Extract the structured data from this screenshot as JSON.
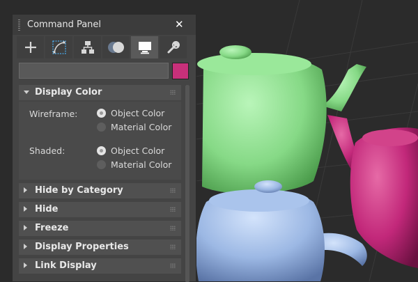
{
  "panel": {
    "title": "Command Panel",
    "close_label": "✕",
    "tabs": [
      {
        "icon": "create-icon",
        "active": false
      },
      {
        "icon": "modify-icon",
        "active": false
      },
      {
        "icon": "hierarchy-icon",
        "active": false
      },
      {
        "icon": "motion-icon",
        "active": false
      },
      {
        "icon": "display-icon",
        "active": true
      },
      {
        "icon": "utilities-icon",
        "active": false
      }
    ],
    "name_field": {
      "value": ""
    },
    "swatch_color": "#c8307a"
  },
  "display_color": {
    "label": "Display Color",
    "wireframe": {
      "label": "Wireframe:",
      "options": [
        "Object Color",
        "Material Color"
      ],
      "selected": "Object Color"
    },
    "shaded": {
      "label": "Shaded:",
      "options": [
        "Object Color",
        "Material Color"
      ],
      "selected": "Object Color"
    }
  },
  "rollouts": [
    {
      "label": "Hide by Category"
    },
    {
      "label": "Hide"
    },
    {
      "label": "Freeze"
    },
    {
      "label": "Display Properties"
    },
    {
      "label": "Link Display"
    }
  ],
  "scene": {
    "teapots": [
      {
        "name": "green-teapot",
        "color": "#8fdc8f"
      },
      {
        "name": "magenta-teapot",
        "color": "#c8307a"
      },
      {
        "name": "blue-teapot",
        "color": "#9db8e4"
      }
    ]
  }
}
